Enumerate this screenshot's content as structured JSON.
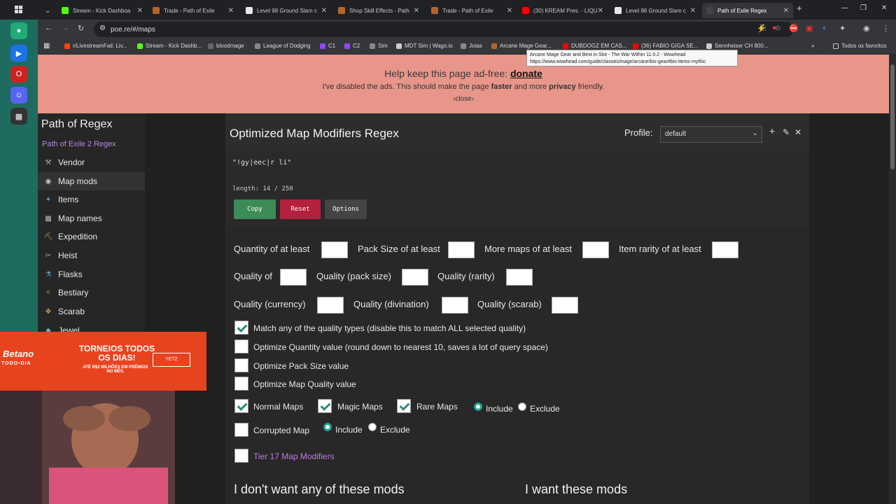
{
  "tabs": [
    {
      "label": "Stream - Kick Dashboa",
      "color": "#53fc18"
    },
    {
      "label": "Trade - Path of Exile",
      "color": "#b5642b"
    },
    {
      "label": "Level 98 Ground Slam c",
      "color": "#e8e8e8"
    },
    {
      "label": "Shop Skill Effects - Path",
      "color": "#b5642b"
    },
    {
      "label": "Trade - Path of Exile",
      "color": "#b5642b"
    },
    {
      "label": "(30) KREAM Pres. - LIQU",
      "color": "#ff0000"
    },
    {
      "label": "Level 98 Ground Slam c",
      "color": "#e8e8e8"
    },
    {
      "label": "Path of Exile Regex",
      "color": "#444444"
    }
  ],
  "url": "poe.re/#/maps",
  "bookmarks": [
    "r/LivestreamFail: Liv...",
    "Stream - Kick Dashb...",
    "bloodmage",
    "League of Dodging",
    "C1",
    "C2",
    "Sim",
    "MDT Sim | Wago.io",
    "Joias",
    "Arcane Mage Gear...",
    "DUBDOGZ EM CAS...",
    "(36) FABIO GIGA SE...",
    "Sennheiser CH 800..."
  ],
  "all_bookmarks": "Todos os favoritos",
  "tooltip": {
    "line1": "Arcane Mage Gear and Best in Slot - The War Within 11.0.2 - Wowhead",
    "line2": "https://www.wowhead.com/guide/classes/mage/arcane/bis-gear#bis-items-mythic"
  },
  "banner": {
    "title_prefix": "Help keep this page ad-free:",
    "title_link": "donate",
    "sub_pre": "I've disabled the ads. This should make the page ",
    "faster": "faster",
    "sub_mid": " and more ",
    "privacy": "privacy",
    "sub_post": " friendly.",
    "close": "‹close›"
  },
  "nav": {
    "brand": "Path of Regex",
    "sub": "Path of Exile 2 Regex",
    "items": [
      "Vendor",
      "Map mods",
      "Items",
      "Map names",
      "Expedition",
      "Heist",
      "Flasks",
      "Bestiary",
      "Scarab",
      "Jewel"
    ]
  },
  "main": {
    "title": "Optimized Map Modifiers Regex",
    "profile_label": "Profile:",
    "profile_value": "default",
    "regex": "\"!gy|eec|r li\"",
    "length": "length: 14 / 250",
    "copy": "Copy",
    "reset": "Reset",
    "options": "Options"
  },
  "fields": {
    "quantity": "Quantity of at least",
    "pack_size": "Pack Size of at least",
    "more_maps": "More maps of at least",
    "item_rarity": "Item rarity of at least",
    "quality_of": "Quality of",
    "q_pack": "Quality (pack size)",
    "q_rarity": "Quality (rarity)",
    "q_currency": "Quality (currency)",
    "q_divination": "Quality (divination)",
    "q_scarab": "Quality (scarab)"
  },
  "checks": {
    "match_any": "Match any of the quality types (disable this to match ALL selected quality)",
    "opt_quantity": "Optimize Quantity value (round down to nearest 10, saves a lot of query space)",
    "opt_pack": "Optimize Pack Size value",
    "opt_quality": "Optimize Map Quality value",
    "normal": "Normal Maps",
    "magic": "Magic Maps",
    "rare": "Rare Maps",
    "include": "Include",
    "exclude": "Exclude",
    "corrupted": "Corrupted Map",
    "tier17": "Tier 17 Map Modifiers"
  },
  "sections": {
    "dont_want": "I don't want any of these mods",
    "want": "I want these mods"
  },
  "ad": {
    "brand": "Betano",
    "brand_sub": "TODO•DIA",
    "headline": "TORNEIOS TODOS OS DIAS!",
    "detail": "ATÉ R$2 MILHÕES EM PRÊMIOS NO MÊS.",
    "code": "YETZ"
  },
  "colors": {
    "banner": "#e8968a",
    "copy": "#3d8b57",
    "reset": "#b3213f",
    "options": "#444444",
    "accent": "#23a08f",
    "link": "#b48be0"
  }
}
